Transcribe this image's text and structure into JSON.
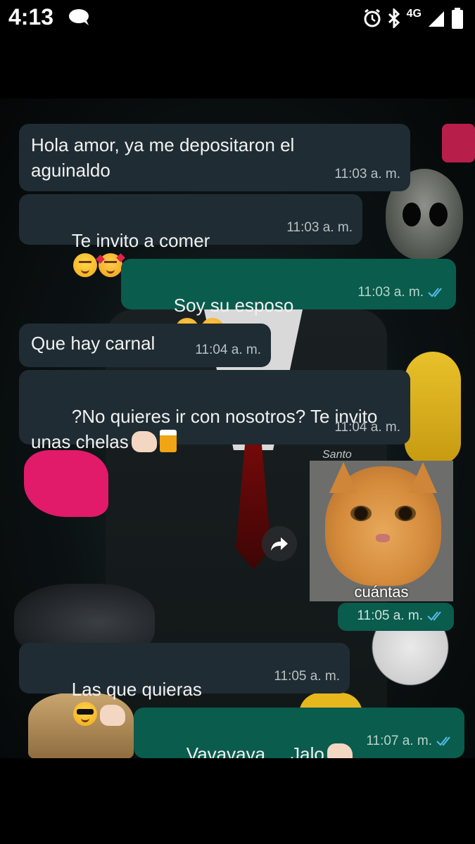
{
  "status_bar": {
    "time": "4:13",
    "network": "4G",
    "icons": [
      "message-icon",
      "alarm-icon",
      "bluetooth-icon",
      "signal-icon",
      "battery-icon"
    ]
  },
  "messages": [
    {
      "direction": "in",
      "text": "Hola amor, ya me depositaron el\naguinaldo",
      "time": "11:03 a. m."
    },
    {
      "direction": "in",
      "text": "Te invito a comer",
      "emojis": [
        "smiling-face",
        "smiling-face-with-hearts"
      ],
      "time": "11:03 a. m."
    },
    {
      "direction": "out",
      "text": "Soy su esposo",
      "emojis": [
        "unamused-face",
        "unamused-face"
      ],
      "time": "11:03 a. m.",
      "read": true
    },
    {
      "direction": "in",
      "text": "Que hay carnal",
      "time": "11:04 a. m."
    },
    {
      "direction": "in",
      "text": "?No quieres ir con nosotros? Te invito\nunas chelas",
      "emojis": [
        "call-me-hand",
        "beer-mug"
      ],
      "time": "11:04 a. m."
    },
    {
      "direction": "out",
      "type": "image",
      "caption": "cuántas",
      "time": "11:05 a. m.",
      "read": true
    },
    {
      "direction": "in",
      "text": "Las que quieras",
      "emojis": [
        "sunglasses-face",
        "call-me-hand"
      ],
      "time": "11:05 a. m."
    },
    {
      "direction": "out",
      "text": "Vavavava.... Jalo",
      "emojis": [
        "call-me-hand"
      ],
      "time": "11:07 a. m.",
      "read": true
    }
  ],
  "wallpaper": {
    "sticker_text": "Santo"
  },
  "colors": {
    "incoming_bubble": "#1f2c33",
    "outgoing_bubble": "#0a5c4d",
    "read_ticks": "#53bdeb",
    "background": "#000000"
  }
}
